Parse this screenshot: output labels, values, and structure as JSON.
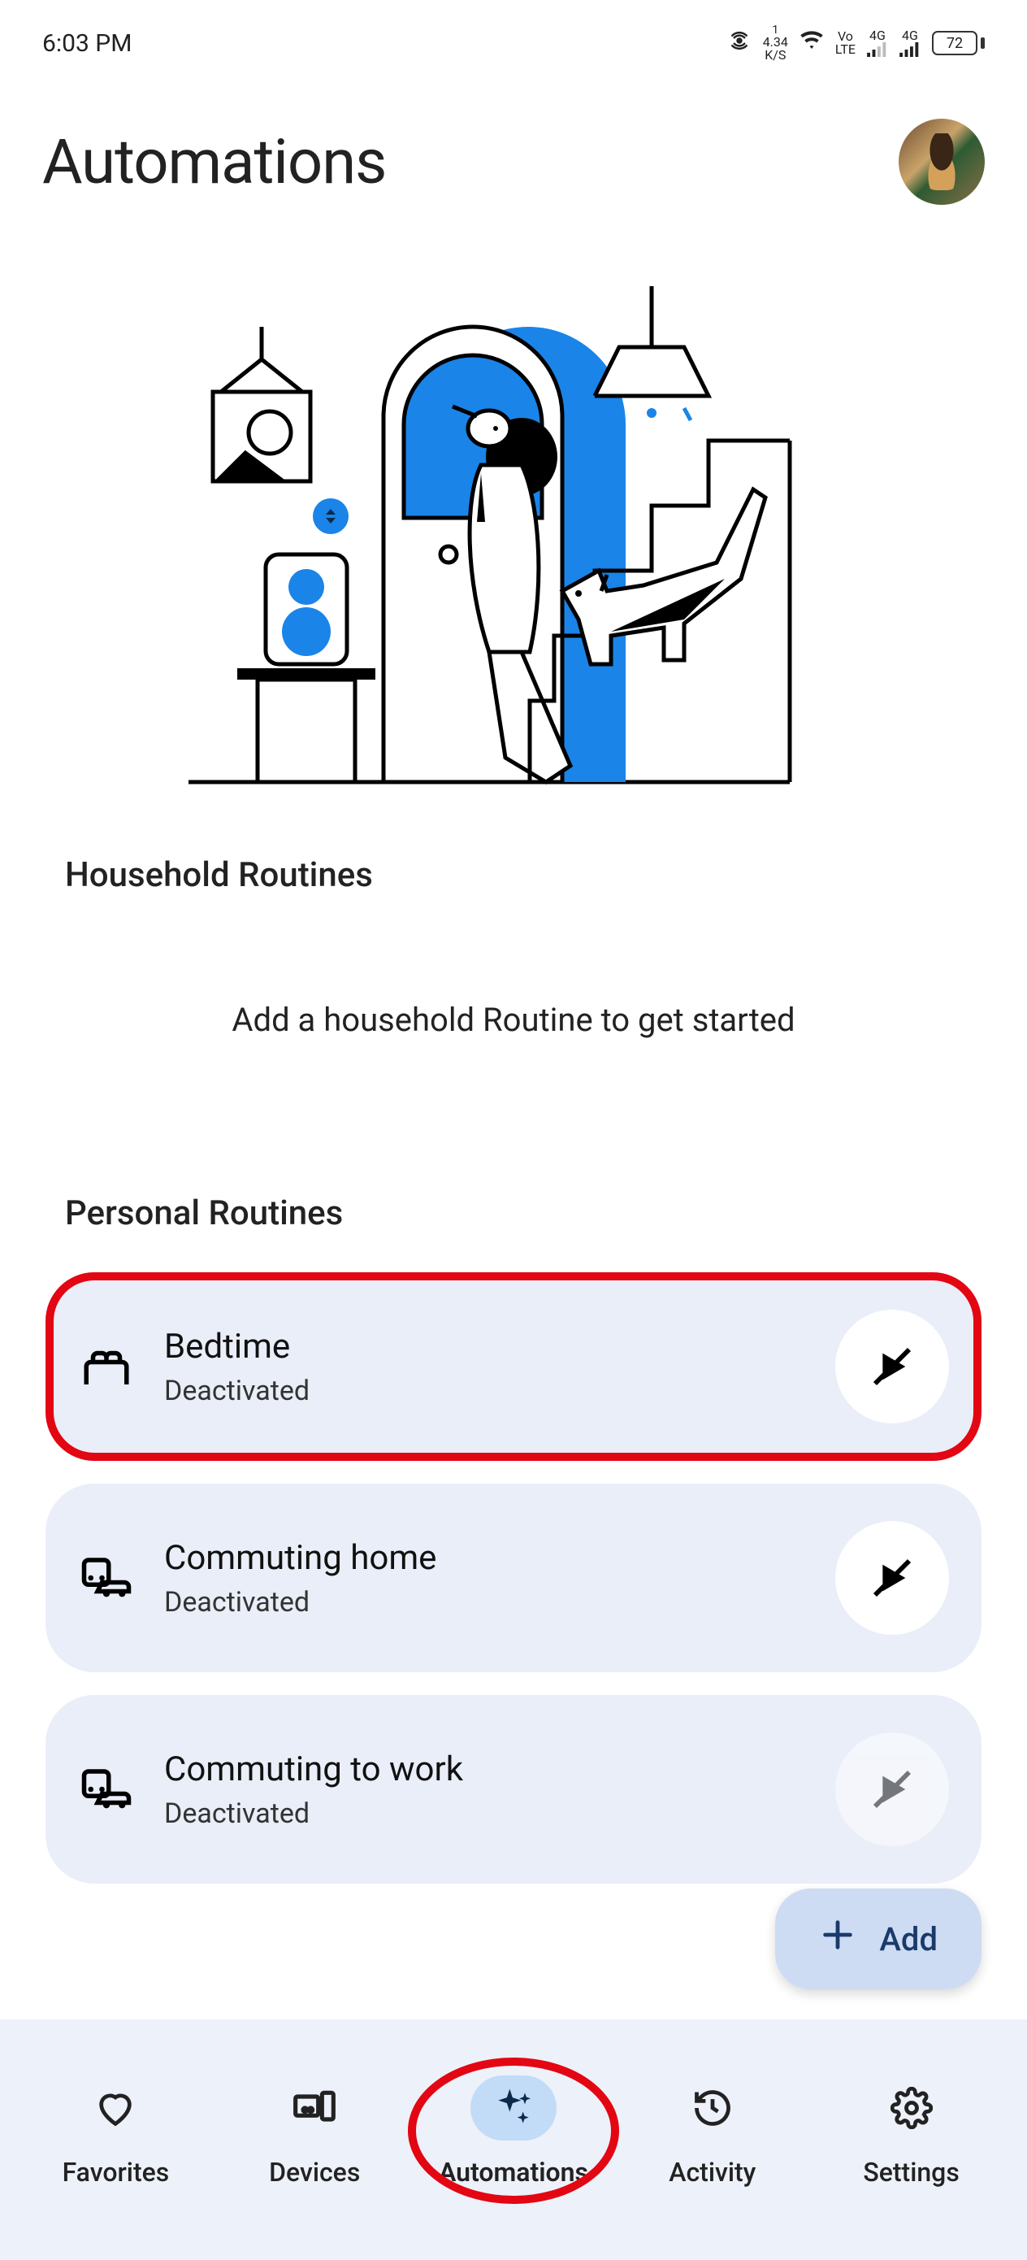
{
  "status": {
    "time": "6:03 PM",
    "net_speed_top": "1",
    "net_speed": "4.34",
    "net_speed_unit": "K/S",
    "vo": "Vo",
    "lte": "LTE",
    "sig1": "4G",
    "sig2": "4G",
    "battery": "72"
  },
  "header": {
    "title": "Automations"
  },
  "sections": {
    "household": {
      "title": "Household Routines",
      "empty_msg": "Add a household Routine to get started"
    },
    "personal": {
      "title": "Personal Routines"
    }
  },
  "routines": [
    {
      "title": "Bedtime",
      "status": "Deactivated",
      "highlighted": true
    },
    {
      "title": "Commuting home",
      "status": "Deactivated",
      "highlighted": false
    },
    {
      "title": "Commuting to work",
      "status": "Deactivated",
      "highlighted": false
    }
  ],
  "fab": {
    "label": "Add"
  },
  "nav": {
    "items": [
      {
        "label": "Favorites",
        "active": false
      },
      {
        "label": "Devices",
        "active": false
      },
      {
        "label": "Automations",
        "active": true
      },
      {
        "label": "Activity",
        "active": false
      },
      {
        "label": "Settings",
        "active": false
      }
    ]
  }
}
